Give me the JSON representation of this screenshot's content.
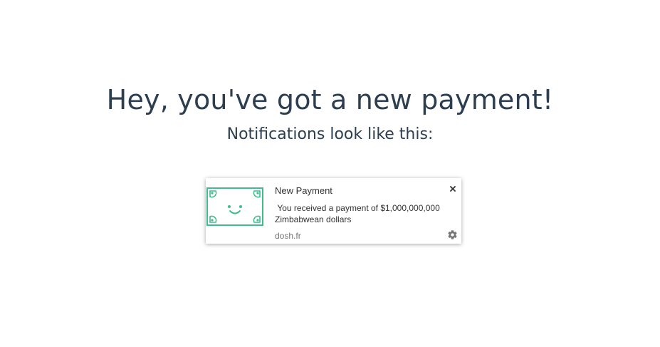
{
  "page": {
    "headline": "Hey, you've got a new payment!",
    "subheadline": "Notifications look like this:"
  },
  "notification": {
    "title": "New Payment",
    "body": " You received a payment of $1,000,000,000\nZimbabwean dollars",
    "source": "dosh.fr",
    "image_icon": "smiling-banknote-icon",
    "close_icon": "close-icon",
    "settings_icon": "gear-icon"
  },
  "colors": {
    "text_dark": "#2c3e50",
    "accent_green": "#3dbd8a",
    "icon_gray": "#757575"
  }
}
